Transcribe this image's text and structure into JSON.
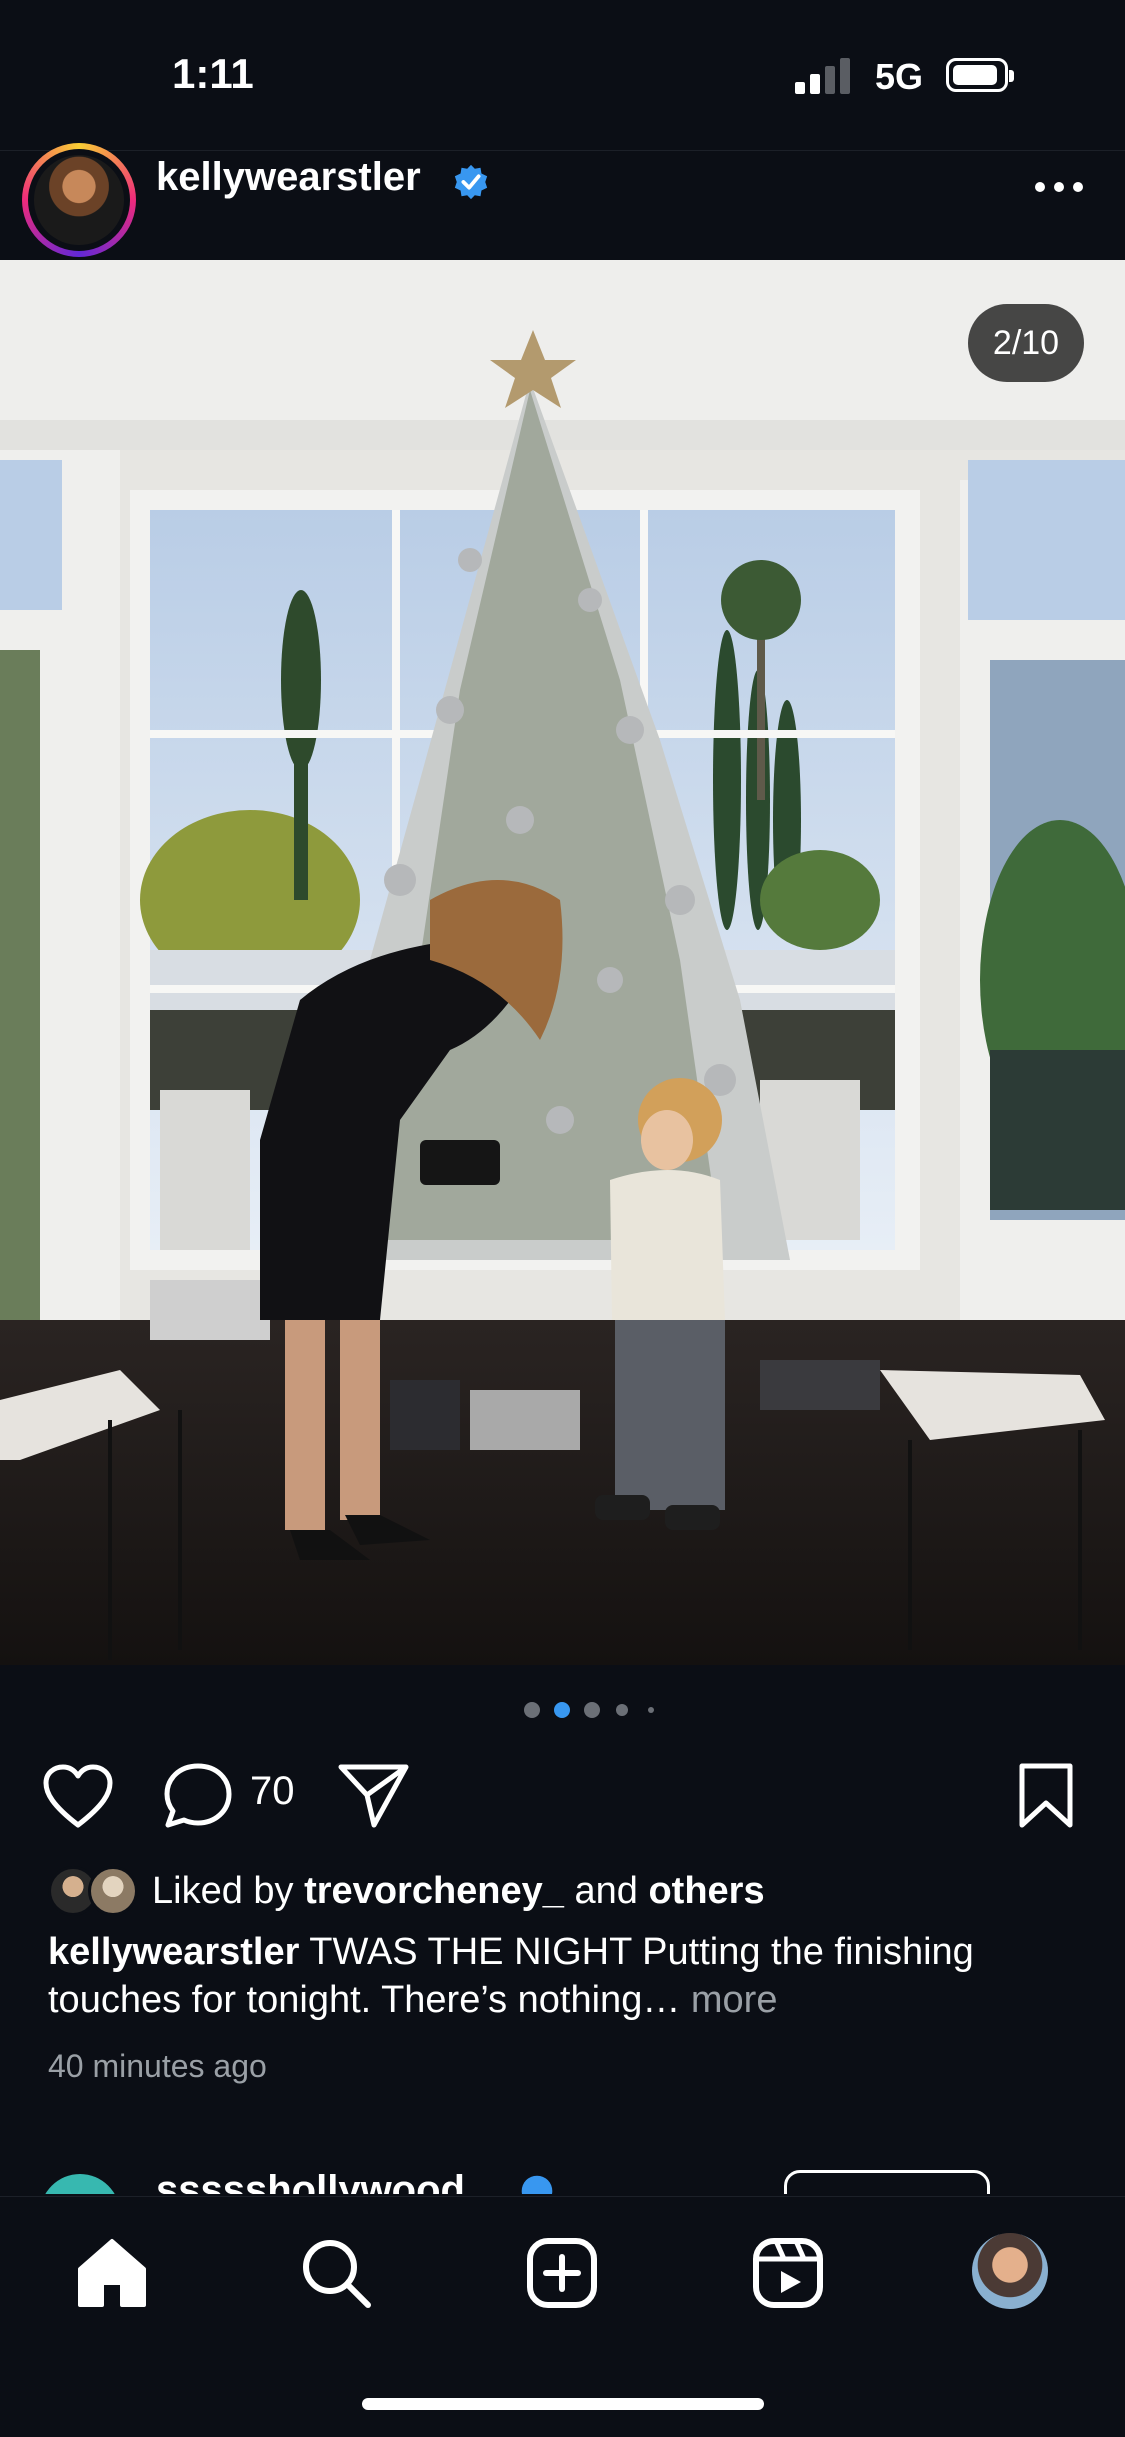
{
  "status_bar": {
    "time": "1:11",
    "network": "5G"
  },
  "post": {
    "username": "kellywearstler",
    "verified": true,
    "more_icon": "ellipsis-icon",
    "image_counter": "2/10",
    "carousel": {
      "total_dots_visible": 5,
      "active_index": 1
    },
    "comment_count": "70",
    "liked_by": {
      "prefix": "Liked by",
      "user": "trevorcheney_",
      "conjunction": "and",
      "suffix": "others"
    },
    "caption": {
      "username": "kellywearstler",
      "text": "TWAS THE NIGHT Putting the finishing touches for tonight. There’s nothing…",
      "more": "more"
    },
    "timestamp": "40 minutes ago"
  },
  "next_post": {
    "username": "ssssshollywood"
  },
  "nav": {
    "items": [
      "home-icon",
      "search-icon",
      "create-icon",
      "reels-icon",
      "profile-avatar"
    ],
    "active": "home-icon"
  },
  "colors": {
    "background": "#0b0e15",
    "verified": "#3897f0",
    "active_dot": "#3897f0",
    "muted": "#9aa0a6"
  }
}
